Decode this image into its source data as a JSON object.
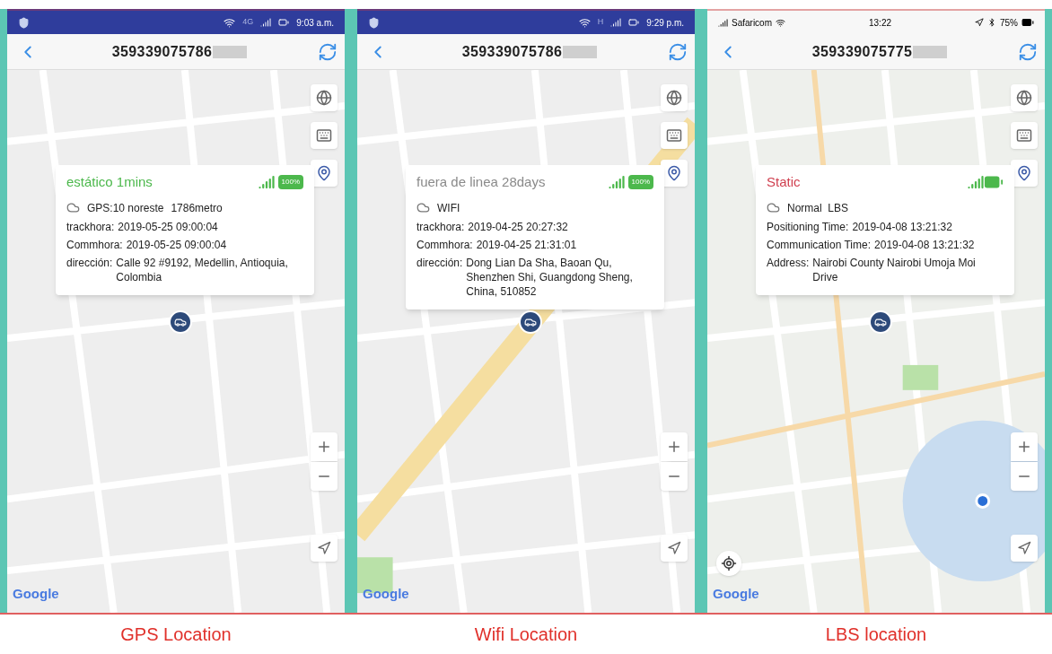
{
  "panels": [
    {
      "kind": "android",
      "status_bar": {
        "network": "4G",
        "time": "9:03 a.m."
      },
      "title": "359339075786",
      "card": {
        "status": {
          "text": "estático 1mins",
          "color": "#4cb84c"
        },
        "battery": "100%",
        "mode": "GPS:10 noreste",
        "altitude": "1786metro",
        "rows": [
          {
            "label": "trackhora:",
            "value": "2019-05-25 09:00:04"
          },
          {
            "label": "Commhora:",
            "value": "2019-05-25 09:00:04"
          },
          {
            "label": "dirección:",
            "value": "Calle 92 #9192, Medellin, Antioquia, Colombia"
          }
        ]
      },
      "logo": "Google",
      "caption": "GPS Location"
    },
    {
      "kind": "android",
      "status_bar": {
        "network": "H",
        "time": "9:29 p.m."
      },
      "title": "359339075786",
      "card": {
        "status": {
          "text": "fuera de linea 28days",
          "color": "#8a8a8a"
        },
        "battery": "100%",
        "mode": "WIFI",
        "rows": [
          {
            "label": "trackhora:",
            "value": "2019-04-25 20:27:32"
          },
          {
            "label": "Commhora:",
            "value": "2019-04-25 21:31:01"
          },
          {
            "label": "dirección:",
            "value": "Dong Lian Da Sha, Baoan Qu, Shenzhen Shi, Guangdong Sheng, China, 510852"
          }
        ]
      },
      "logo": "Google",
      "caption": "Wifi Location"
    },
    {
      "kind": "ios",
      "status_bar": {
        "carrier": "Safaricom",
        "time": "13:22",
        "battery": "75%"
      },
      "title": "359339075775",
      "card": {
        "status": {
          "text": "Static",
          "color": "#d04050"
        },
        "mode": "Normal  LBS",
        "rows": [
          {
            "label": "Positioning Time:",
            "value": "2019-04-08 13:21:32"
          },
          {
            "label": "Communication Time:",
            "value": "2019-04-08 13:21:32"
          },
          {
            "label": "Address:",
            "value": "Nairobi County Nairobi Umoja Moi Drive"
          }
        ]
      },
      "logo": "Google",
      "caption": "LBS location"
    }
  ]
}
